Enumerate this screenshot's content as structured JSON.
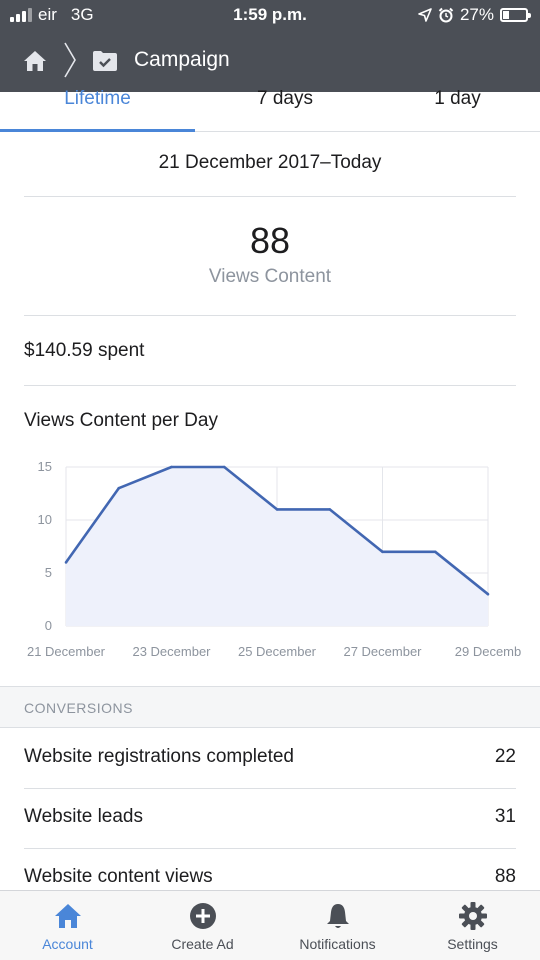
{
  "status_bar": {
    "carrier": "eir",
    "network": "3G",
    "time": "1:59 p.m.",
    "battery": "27%",
    "battery_level": 0.27
  },
  "nav": {
    "title": "Campaign",
    "home_icon": "home-icon",
    "folder_icon": "folder-check-icon"
  },
  "tabs": [
    {
      "label": "Lifetime",
      "active": true
    },
    {
      "label": "7 days",
      "active": false
    },
    {
      "label": "1 day",
      "active": false
    }
  ],
  "date_range": "21 December 2017–Today",
  "metric": {
    "value": "88",
    "label": "Views Content"
  },
  "spent": "$140.59 spent",
  "chart_title": "Views Content per Day",
  "chart_data": {
    "type": "area",
    "title": "Views Content per Day",
    "x": [
      "21 December",
      "22 December",
      "23 December",
      "24 December",
      "25 December",
      "26 December",
      "27 December",
      "28 December",
      "29 December"
    ],
    "tick_labels": [
      "21 December",
      "23 December",
      "25 December",
      "27 December",
      "29 Decemb"
    ],
    "y_ticks": [
      "15",
      "10",
      "5",
      "0"
    ],
    "series": [
      {
        "values": [
          6,
          13,
          15,
          15,
          11,
          11,
          7,
          7,
          3
        ]
      }
    ],
    "ylim": [
      0,
      15
    ],
    "grid": true,
    "colors": {
      "line": "#4267b2",
      "fill": "#eef1fb",
      "grid": "#e4e6eb"
    }
  },
  "conversions": {
    "header": "CONVERSIONS",
    "rows": [
      {
        "label": "Website registrations completed",
        "value": "22"
      },
      {
        "label": "Website leads",
        "value": "31"
      },
      {
        "label": "Website content views",
        "value": "88"
      }
    ]
  },
  "bottom_nav": [
    {
      "label": "Account",
      "icon": "home-icon",
      "active": true
    },
    {
      "label": "Create Ad",
      "icon": "plus-circle-icon",
      "active": false
    },
    {
      "label": "Notifications",
      "icon": "bell-icon",
      "active": false
    },
    {
      "label": "Settings",
      "icon": "gear-icon",
      "active": false
    }
  ],
  "colors": {
    "accent": "#4a86d8",
    "header_bg": "#4b4f56",
    "muted_text": "#8d949e"
  }
}
